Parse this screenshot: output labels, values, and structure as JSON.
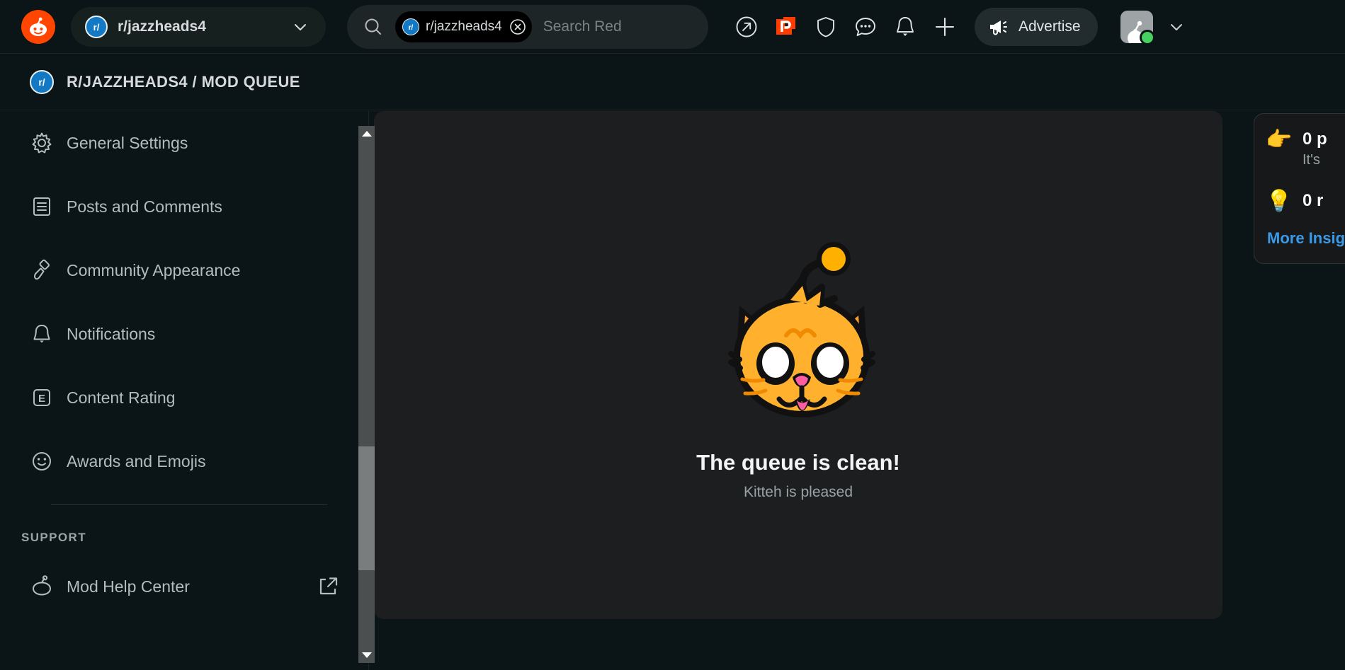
{
  "header": {
    "logo_icon": "reddit-logo-icon",
    "community_switcher": {
      "name": "r/jazzheads4",
      "avatar_icon": "subreddit-avatar-icon",
      "chevron_icon": "chevron-down-icon"
    },
    "search": {
      "search_icon": "search-icon",
      "chip_label": "r/jazzheads4",
      "chip_avatar_icon": "subreddit-avatar-icon",
      "chip_close_icon": "close-circle-icon",
      "placeholder": "Search Red"
    },
    "actions": [
      {
        "name": "popular",
        "icon": "arrow-up-right-circle-icon"
      },
      {
        "name": "reddit-pro",
        "icon": "reddit-pro-icon"
      },
      {
        "name": "mod-tools",
        "icon": "shield-icon"
      },
      {
        "name": "chat",
        "icon": "chat-bubble-icon"
      },
      {
        "name": "notifications",
        "icon": "bell-icon"
      },
      {
        "name": "create-post",
        "icon": "plus-icon"
      }
    ],
    "advertise": {
      "label": "Advertise",
      "icon": "megaphone-icon"
    },
    "account": {
      "avatar_icon": "user-avatar-icon",
      "online_status": "online",
      "chevron_icon": "chevron-down-icon"
    }
  },
  "breadcrumb": {
    "avatar_icon": "subreddit-avatar-icon",
    "title": "R/JAZZHEADS4 / MOD QUEUE"
  },
  "sidebar": {
    "items": [
      {
        "label": "General Settings",
        "icon": "gear-icon"
      },
      {
        "label": "Posts and Comments",
        "icon": "document-lines-icon"
      },
      {
        "label": "Community Appearance",
        "icon": "paintbrush-icon"
      },
      {
        "label": "Notifications",
        "icon": "bell-icon"
      },
      {
        "label": "Content Rating",
        "icon": "content-rating-e-icon"
      },
      {
        "label": "Awards and Emojis",
        "icon": "smiley-face-icon"
      }
    ],
    "support_header": "SUPPORT",
    "support_items": [
      {
        "label": "Mod Help Center",
        "icon": "snoo-icon",
        "external_icon": "external-link-icon"
      }
    ]
  },
  "main": {
    "illustration": "kitteh-snoo-mascot",
    "title": "The queue is clean!",
    "subtitle": "Kitteh is pleased"
  },
  "insights": {
    "rows": [
      {
        "emoji": "👉",
        "emoji_name": "foam-finger-emoji",
        "title": "0 p",
        "sub": "It's"
      },
      {
        "emoji": "💡",
        "emoji_name": "lightbulb-emoji",
        "title": "0 r",
        "sub": ""
      }
    ],
    "more_link": "More Insig"
  },
  "scrollbar": {
    "up_arrow_icon": "scroll-up-arrow-icon",
    "down_arrow_icon": "scroll-down-arrow-icon"
  },
  "colors": {
    "brand_orange": "#ff4500",
    "page_bg": "#0b1416",
    "panel_bg": "#1d1e20",
    "link_blue": "#3a9ae8",
    "online_green": "#46d160",
    "subreddit_blue": "#1479c4"
  }
}
